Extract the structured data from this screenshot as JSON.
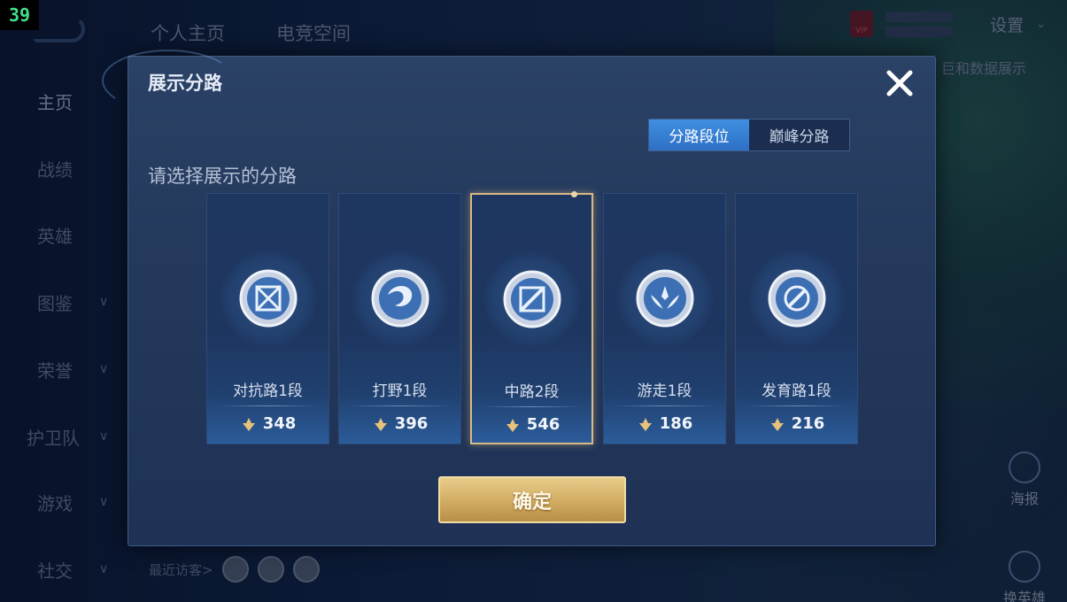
{
  "frame_number": "39",
  "topnav": {
    "items": [
      "个人主页",
      "电竞空间"
    ]
  },
  "topright": {
    "vip_badge": "VIP",
    "settings": "设置",
    "data_show_text": "巨和数据展示"
  },
  "sidebar": {
    "items": [
      {
        "label": "主页"
      },
      {
        "label": "战绩"
      },
      {
        "label": "英雄"
      },
      {
        "label": "图鉴"
      },
      {
        "label": "荣誉"
      },
      {
        "label": "护卫队"
      },
      {
        "label": "游戏"
      },
      {
        "label": "社交"
      }
    ]
  },
  "bottom": {
    "visitors_label": "最近访客>"
  },
  "right_buttons": {
    "poster": "海报",
    "swap_hero": "换英雄"
  },
  "modal": {
    "title": "展示分路",
    "tabs": [
      {
        "label": "分路段位"
      },
      {
        "label": "巅峰分路"
      }
    ],
    "active_tab": "分路段位",
    "prompt": "请选择展示的分路",
    "cards": [
      {
        "label": "对抗路1段",
        "score": "348",
        "icon": "clash-lane-icon"
      },
      {
        "label": "打野1段",
        "score": "396",
        "icon": "jungle-dragon-icon"
      },
      {
        "label": "中路2段",
        "score": "546",
        "icon": "mid-lane-icon",
        "selected": true
      },
      {
        "label": "游走1段",
        "score": "186",
        "icon": "roam-wings-icon"
      },
      {
        "label": "发育路1段",
        "score": "216",
        "icon": "farm-lane-icon"
      }
    ],
    "confirm": "确定"
  },
  "colors": {
    "accent_blue": "#3f8fe0",
    "gold": "#d9b985",
    "panel": "#24395c"
  }
}
